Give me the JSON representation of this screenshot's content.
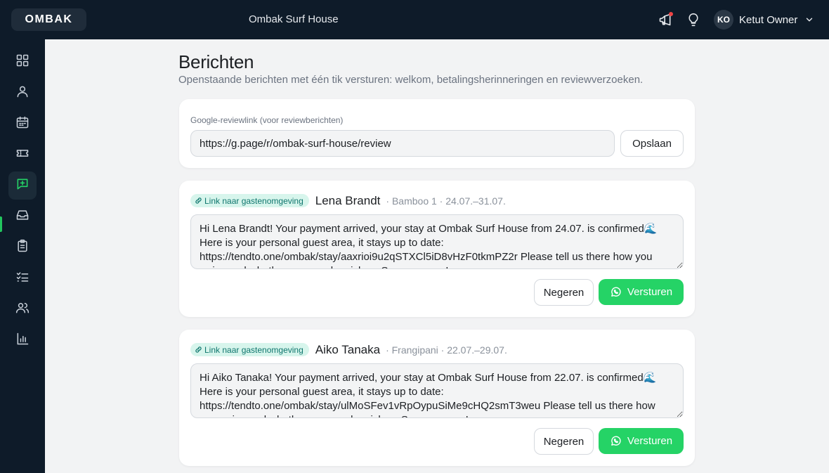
{
  "app": {
    "logo": "OMBAK",
    "property_name": "Ombak Surf House"
  },
  "user": {
    "initials": "KO",
    "name": "Ketut Owner"
  },
  "header_icons": [
    "megaphone-icon",
    "lightbulb-icon",
    "chevron-down-icon"
  ],
  "sidebar": {
    "items": [
      {
        "icon": "dashboard-grid-icon",
        "active": false
      },
      {
        "icon": "user-icon",
        "active": false
      },
      {
        "icon": "calendar-icon",
        "active": false
      },
      {
        "icon": "ticket-icon",
        "active": false
      },
      {
        "icon": "message-plus-icon",
        "active": true
      },
      {
        "icon": "inbox-icon",
        "active": false
      },
      {
        "icon": "clipboard-icon",
        "active": false
      },
      {
        "icon": "checklist-icon",
        "active": false
      },
      {
        "icon": "users-icon",
        "active": false
      },
      {
        "icon": "bar-chart-icon",
        "active": false
      }
    ]
  },
  "page": {
    "title": "Berichten",
    "subtitle": "Openstaande berichten met één tik versturen: welkom, betalingsherinneringen en reviewverzoeken."
  },
  "review": {
    "label": "Google-reviewlink (voor reviewberichten)",
    "value": "https://g.page/r/ombak-surf-house/review",
    "save_label": "Opslaan"
  },
  "messages": [
    {
      "link_label": "Link naar gastenomgeving",
      "guest": "Lena Brandt",
      "meta": "· Bamboo 1 · 24.07.–31.07.",
      "text": "Hi Lena Brandt! Your payment arrived, your stay at Ombak Surf House from 24.07. is confirmed🌊 Here is your personal guest area, it stays up to date: https://tendto.one/ombak/stay/aaxrioi9u2qSTXCl5iD8vHzF0tkmPZ2r Please tell us there how you arrive and whether you need a pickup. See you soon!",
      "ignore_label": "Negeren",
      "send_label": "Versturen"
    },
    {
      "link_label": "Link naar gastenomgeving",
      "guest": "Aiko Tanaka",
      "meta": "· Frangipani · 22.07.–29.07.",
      "text": "Hi Aiko Tanaka! Your payment arrived, your stay at Ombak Surf House from 22.07. is confirmed🌊 Here is your personal guest area, it stays up to date: https://tendto.one/ombak/stay/ulMoSFev1vRpOypuSiMe9cHQ2smT3weu Please tell us there how you arrive and whether you need a pickup. See you soon!",
      "ignore_label": "Negeren",
      "send_label": "Versturen"
    }
  ],
  "colors": {
    "sidebar_bg": "#0e1b29",
    "accent": "#22c55e",
    "whatsapp": "#25d366",
    "link_badge_bg": "#d7f5ec",
    "link_badge_text": "#0f766e"
  }
}
